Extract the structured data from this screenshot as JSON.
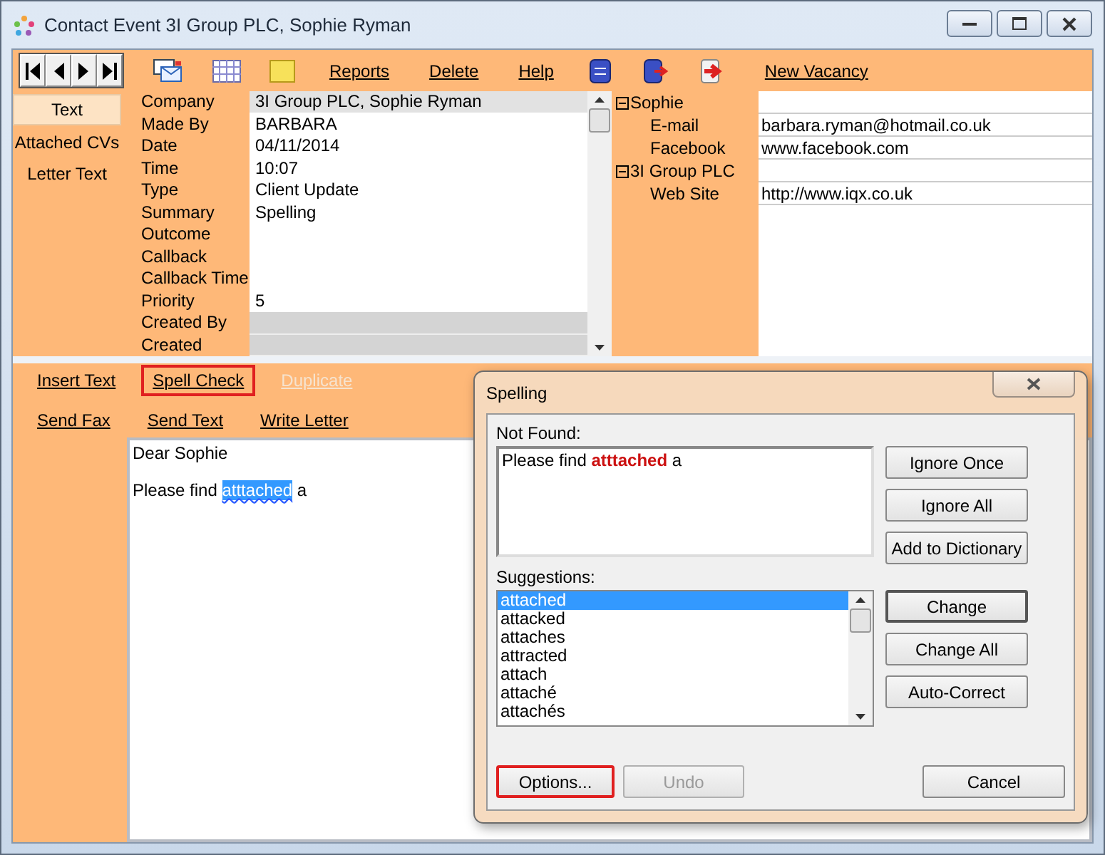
{
  "window": {
    "title": "Contact Event 3I Group PLC, Sophie Ryman"
  },
  "toolbar": {
    "links": [
      "Reports",
      "Delete",
      "Help"
    ],
    "end_link": "New Vacancy"
  },
  "sidebar": {
    "tabs": [
      {
        "label": "Text",
        "selected": true
      },
      {
        "label": "Attached CVs",
        "selected": false
      },
      {
        "label": "Letter Text",
        "selected": false
      }
    ]
  },
  "details": {
    "rows": [
      {
        "label": "Company",
        "value": "3I Group PLC, Sophie Ryman",
        "selected": true,
        "disabled": false
      },
      {
        "label": "Made By",
        "value": "BARBARA",
        "selected": false,
        "disabled": false
      },
      {
        "label": "Date",
        "value": "04/11/2014",
        "selected": false,
        "disabled": false
      },
      {
        "label": "Time",
        "value": "10:07",
        "selected": false,
        "disabled": false
      },
      {
        "label": "Type",
        "value": "Client Update",
        "selected": false,
        "disabled": false
      },
      {
        "label": "Summary",
        "value": "Spelling",
        "selected": false,
        "disabled": false
      },
      {
        "label": "Outcome",
        "selected": false,
        "disabled": false
      },
      {
        "label": "Callback",
        "selected": false,
        "disabled": false
      },
      {
        "label": "Callback Time",
        "selected": false,
        "disabled": false
      },
      {
        "label": "Priority",
        "value": "5",
        "selected": false,
        "disabled": false
      },
      {
        "label": "Created By",
        "selected": false,
        "disabled": true
      },
      {
        "label": "Created",
        "selected": false,
        "disabled": true
      }
    ]
  },
  "contacts": {
    "tree": [
      {
        "label": "Sophie",
        "expanded": true,
        "children": [
          {
            "label": "E-mail",
            "value": "barbara.ryman@hotmail.co.uk"
          },
          {
            "label": "Facebook",
            "value": "www.facebook.com"
          }
        ]
      },
      {
        "label": "3I Group PLC",
        "expanded": true,
        "children": [
          {
            "label": "Web Site",
            "value": "http://www.iqx.co.uk"
          }
        ]
      }
    ]
  },
  "actions": {
    "rows": [
      [
        {
          "label": "Insert Text",
          "highlighted": false,
          "disabled": false
        },
        {
          "label": "Spell Check",
          "highlighted": true,
          "disabled": false
        },
        {
          "label": "Duplicate",
          "highlighted": false,
          "disabled": true
        }
      ],
      [
        {
          "label": "Send Fax",
          "highlighted": false,
          "disabled": false
        },
        {
          "label": "Send Text",
          "highlighted": false,
          "disabled": false
        },
        {
          "label": "Write Letter",
          "highlighted": false,
          "disabled": false
        }
      ]
    ]
  },
  "letter": {
    "greeting": "Dear Sophie",
    "line": {
      "before": "Please find ",
      "selected": "atttached",
      "after": " a"
    }
  },
  "dialog": {
    "title": "Spelling",
    "not_found_label": "Not Found:",
    "not_found": {
      "before": "Please find ",
      "word": "atttached",
      "after": " a"
    },
    "suggestions_label": "Suggestions:",
    "suggestions": [
      {
        "text": "attached",
        "selected": true
      },
      {
        "text": "attacked",
        "selected": false
      },
      {
        "text": "attaches",
        "selected": false
      },
      {
        "text": "attracted",
        "selected": false
      },
      {
        "text": "attach",
        "selected": false
      },
      {
        "text": "attaché",
        "selected": false
      },
      {
        "text": "attachés",
        "selected": false
      }
    ],
    "top_buttons": [
      "Ignore Once",
      "Ignore All",
      "Add to Dictionary"
    ],
    "side_buttons": [
      {
        "label": "Change",
        "default": true
      },
      {
        "label": "Change All",
        "default": false
      },
      {
        "label": "Auto-Correct",
        "default": false
      }
    ],
    "bottom_buttons": [
      {
        "label": "Options...",
        "highlighted": true,
        "disabled": false
      },
      {
        "label": "Undo",
        "highlighted": false,
        "disabled": true
      }
    ],
    "cancel_button": {
      "label": "Cancel"
    }
  }
}
